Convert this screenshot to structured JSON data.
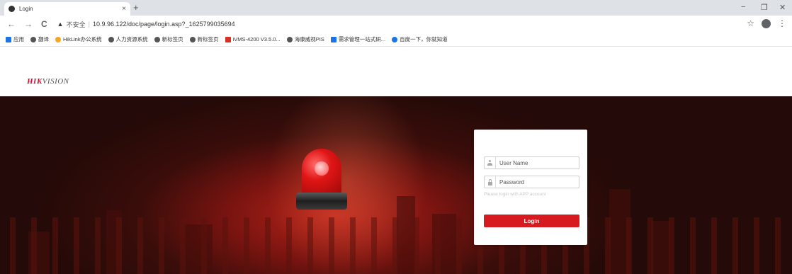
{
  "browser": {
    "tab_title": "Login",
    "tab_close": "×",
    "new_tab": "+",
    "window_controls": [
      "−",
      "❐",
      "✕"
    ],
    "nav_back": "←",
    "nav_forward": "→",
    "nav_reload": "C",
    "warning_icon": "▲",
    "insecure_label": "不安全",
    "separator": "|",
    "url": "10.9.96.122/doc/page/login.asp?_1625799035694",
    "star_icon": "☆",
    "menu_icon": "⋮"
  },
  "bookmarks": [
    {
      "label": "应用",
      "icon": "apps-grid-icon"
    },
    {
      "label": "翻译",
      "icon": "globe-icon"
    },
    {
      "label": "HikLink办公系统",
      "icon": "hiklink-icon"
    },
    {
      "label": "人力资源系统",
      "icon": "globe-icon"
    },
    {
      "label": "新标签页",
      "icon": "globe-icon"
    },
    {
      "label": "新标签页",
      "icon": "globe-icon"
    },
    {
      "label": "iVMS-4200 V3.5.0...",
      "icon": "ivms-icon"
    },
    {
      "label": "海康威视PIS",
      "icon": "globe-icon"
    },
    {
      "label": "需求管理一站式研...",
      "icon": "lightning-icon"
    },
    {
      "label": "百度一下，你就知道",
      "icon": "baidu-paw-icon"
    }
  ],
  "header": {
    "logo_brand": "HIK",
    "logo_rest": "VISION"
  },
  "login": {
    "username_placeholder": "User Name",
    "password_placeholder": "Password",
    "hint": "Please login with APP account",
    "button_label": "Login",
    "button_color": "#d71920"
  },
  "colors": {
    "brand_red": "#c8102e",
    "banner_dark": "#240a08"
  }
}
